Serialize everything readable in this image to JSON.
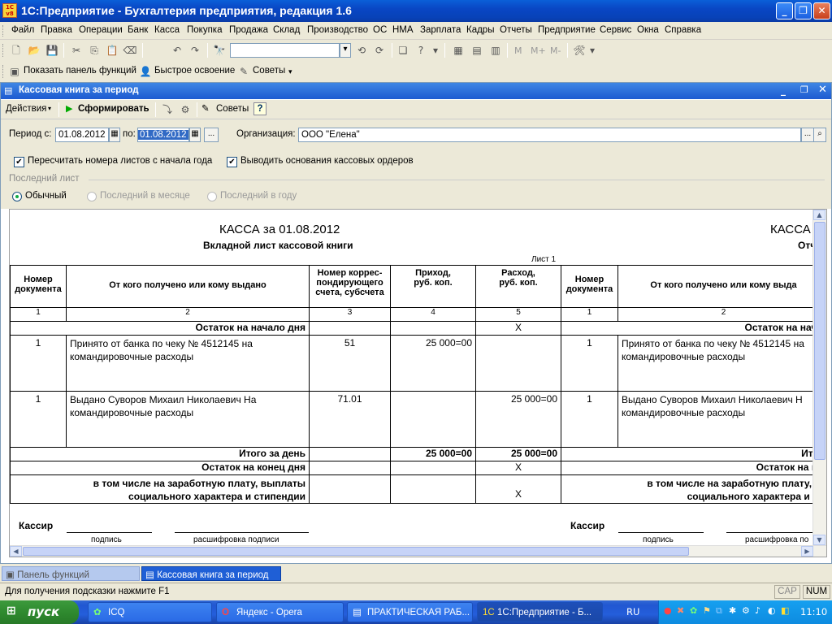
{
  "window": {
    "title": "1С:Предприятие - Бухгалтерия предприятия, редакция 1.6",
    "logo_text": "1С v8"
  },
  "menu": [
    "Файл",
    "Правка",
    "Операции",
    "Банк",
    "Касса",
    "Покупка",
    "Продажа",
    "Склад",
    "Производство",
    "ОС",
    "НМА",
    "Зарплата",
    "Кадры",
    "Отчеты",
    "Предприятие",
    "Сервис",
    "Окна",
    "Справка"
  ],
  "toolbar3": {
    "functions_panel": "Показать панель функций",
    "quick_learn": "Быстрое освоение",
    "tips": "Советы"
  },
  "toolbar2": {
    "m": "M",
    "mplus": "M+",
    "mminus": "M-"
  },
  "doc": {
    "title": "Кассовая книга за период",
    "actions": "Действия",
    "generate": "Сформировать",
    "tips": "Советы",
    "period_from_label": "Период с:",
    "period_from": "01.08.2012",
    "period_to_label": "по:",
    "period_to": "01.08.2012",
    "org_label": "Организация:",
    "org": "ООО \"Елена\"",
    "chk1": "Пересчитать номера листов с начала года",
    "chk2": "Выводить основания кассовых ордеров",
    "last_sheet": "Последний лист",
    "radio1": "Обычный",
    "radio2": "Последний в месяце",
    "radio3": "Последний в году"
  },
  "report": {
    "title": "КАССА за 01.08.2012",
    "subtitle": "Вкладной лист кассовой книги",
    "title2": "КАССА",
    "subtitle2": "Отч",
    "sheet_no": "Лист 1",
    "headers": [
      "Номер документа",
      "От кого получено или кому выдано",
      "Номер коррес-пондирующего счета, субсчета",
      "Приход, руб. коп.",
      "Расход, руб. коп.",
      "Номер документа",
      "От кого получено или кому выда"
    ],
    "colnums": [
      "1",
      "2",
      "3",
      "4",
      "5",
      "1",
      "2"
    ],
    "opening": "Остаток на начало дня",
    "opening2": "Остаток на нача",
    "x": "X",
    "rows": [
      {
        "num": "1",
        "text": "Принято от банка по чеку № 4512145 на командировочные расходы",
        "acc": "51",
        "in": "25 000=00",
        "out": "",
        "num2": "1",
        "text2": "Принято от банка по чеку № 4512145 на командировочные расходы"
      },
      {
        "num": "1",
        "text": "Выдано Суворов Михаил Николаевич На командировочные расходы",
        "acc": "71.01",
        "in": "",
        "out": "25 000=00",
        "num2": "1",
        "text2": "Выдано Суворов Михаил Николаевич Н командировочные расходы"
      }
    ],
    "total_day": "Итого за день",
    "total_in": "25 000=00",
    "total_out": "25 000=00",
    "total_day2": "Итого",
    "closing": "Остаток на конец  дня",
    "closing2": "Остаток на ко",
    "incl": "в том числе на заработную плату, выплаты социального характера и стипендии",
    "incl2a": "в том числе на заработную плату, вы",
    "incl2b": "социального характера и сти",
    "cashier": "Кассир",
    "signature": "подпись",
    "decode": "расшифровка подписи",
    "decode2": "расшифровка по"
  },
  "tabs": [
    "Панель функций",
    "Кассовая книга за период"
  ],
  "status": {
    "hint": "Для получения подсказки нажмите F1",
    "cap": "CAP",
    "num": "NUM"
  },
  "taskbar": {
    "start": "пуск",
    "tasks": [
      "ICQ",
      "Яндекс - Opera",
      "ПРАКТИЧЕСКАЯ РАБ...",
      "1С:Предприятие - Б..."
    ],
    "lang": "RU",
    "clock": "11:10"
  }
}
